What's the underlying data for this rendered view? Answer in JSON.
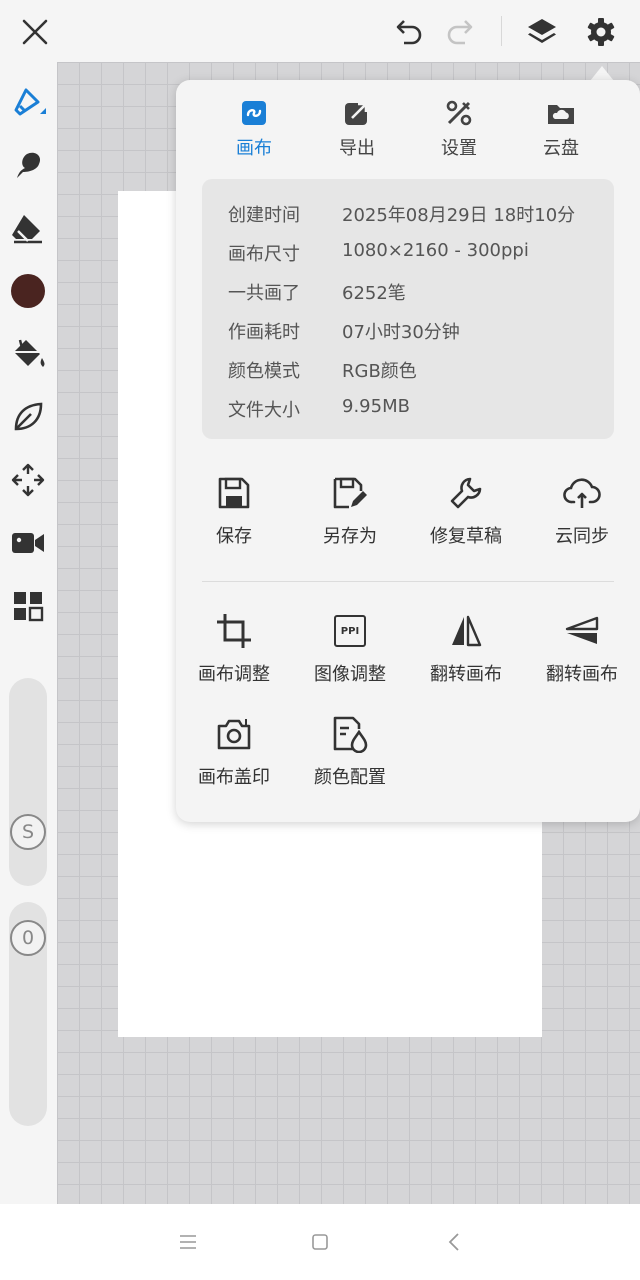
{
  "topbar": {
    "close_icon": "close-icon",
    "undo_icon": "undo-icon",
    "redo_icon": "redo-icon",
    "layers_icon": "layers-icon",
    "settings_icon": "gear-icon"
  },
  "left_toolbar": {
    "tools": [
      "brush-icon",
      "smudge-icon",
      "eraser-icon",
      "color-swatch",
      "paint-bucket-icon",
      "leaf-icon",
      "move-icon",
      "video-icon",
      "grid-icon"
    ],
    "current_color": "#4a2420",
    "size_slider_label": "S",
    "opacity_slider_label": "0"
  },
  "popup": {
    "tabs": [
      {
        "label": "画布",
        "icon": "canvas-icon",
        "active": true
      },
      {
        "label": "导出",
        "icon": "export-icon",
        "active": false
      },
      {
        "label": "设置",
        "icon": "settings-tools-icon",
        "active": false
      },
      {
        "label": "云盘",
        "icon": "cloud-drive-icon",
        "active": false
      }
    ],
    "info": [
      {
        "key": "创建时间",
        "value": "2025年08月29日 18时10分"
      },
      {
        "key": "画布尺寸",
        "value": "1080×2160 - 300ppi"
      },
      {
        "key": "一共画了",
        "value": "6252笔"
      },
      {
        "key": "作画耗时",
        "value": "07小时30分钟"
      },
      {
        "key": "颜色模式",
        "value": "RGB颜色"
      },
      {
        "key": "文件大小",
        "value": "9.95MB"
      }
    ],
    "actions_row1": [
      {
        "label": "保存",
        "icon": "save-icon"
      },
      {
        "label": "另存为",
        "icon": "save-as-icon"
      },
      {
        "label": "修复草稿",
        "icon": "wrench-icon"
      },
      {
        "label": "云同步",
        "icon": "cloud-sync-icon"
      }
    ],
    "actions_row2": [
      {
        "label": "画布调整",
        "icon": "crop-icon"
      },
      {
        "label": "图像调整",
        "icon": "ppi-icon",
        "icon_text": "PPI"
      },
      {
        "label": "翻转画布",
        "icon": "flip-horizontal-icon"
      },
      {
        "label": "翻转画布",
        "icon": "flip-vertical-icon"
      }
    ],
    "actions_row3": [
      {
        "label": "画布盖印",
        "icon": "camera-icon"
      },
      {
        "label": "颜色配置",
        "icon": "color-profile-icon"
      }
    ]
  },
  "colors": {
    "accent": "#1a7fd6",
    "icon": "#333333",
    "canvas_bg": "#d5d5d7"
  },
  "navbar": {
    "menu_icon": "menu-icon",
    "home_icon": "home-square-icon",
    "back_icon": "back-chevron-icon"
  }
}
